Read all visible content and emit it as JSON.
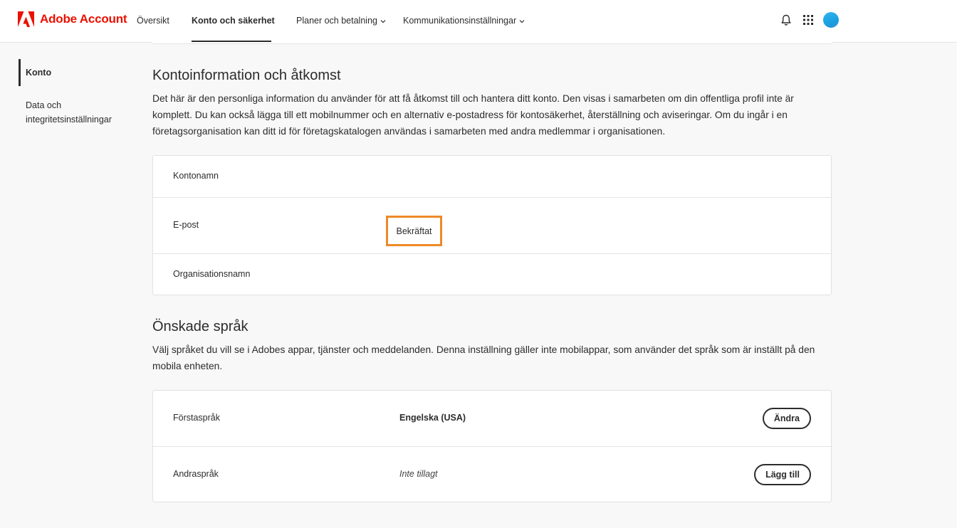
{
  "header": {
    "brand": "Adobe Account",
    "nav": [
      {
        "label": "Översikt",
        "has_dropdown": false,
        "active": false
      },
      {
        "label": "Konto och säkerhet",
        "has_dropdown": true,
        "active": true
      },
      {
        "label": "Planer och betalning",
        "has_dropdown": true,
        "active": false
      },
      {
        "label": "Kommunikationsinställningar",
        "has_dropdown": true,
        "active": false
      }
    ],
    "icons": [
      "bell-icon",
      "app-grid-icon",
      "avatar"
    ]
  },
  "sidebar": {
    "items": [
      {
        "label": "Konto",
        "active": true
      },
      {
        "label": "Data och integritetsinställningar",
        "active": false
      }
    ]
  },
  "account_section": {
    "title": "Kontoinformation och åtkomst",
    "description": "Det här är den personliga information du använder för att få åtkomst till och hantera ditt konto. Den visas i samarbeten om din offentliga profil inte är komplett. Du kan också lägga till ett mobilnummer och en alternativ e-postadress för kontosäkerhet, återställning och aviseringar. Om du ingår i en företagsorganisation kan ditt id för företagskatalogen användas i samarbeten med andra medlemmar i organisationen.",
    "rows": [
      {
        "label": "Kontonamn",
        "value": ""
      },
      {
        "label": "E-post",
        "status": "Bekräftat"
      },
      {
        "label": "Organisationsnamn",
        "value": ""
      }
    ]
  },
  "language_section": {
    "title": "Önskade språk",
    "description": "Välj språket du vill se i Adobes appar, tjänster och meddelanden. Denna inställning gäller inte mobilappar, som använder det språk som är inställt på den mobila enheten.",
    "rows": [
      {
        "label": "Förstaspråk",
        "value": "Engelska (USA)",
        "button": "Ändra"
      },
      {
        "label": "Andraspråk",
        "value": "Inte tillagt",
        "button": "Lägg till"
      }
    ]
  },
  "colors": {
    "brand_red": "#eb1000",
    "highlight_orange": "#ee8a28",
    "avatar_blue": "#1aa0e0"
  }
}
